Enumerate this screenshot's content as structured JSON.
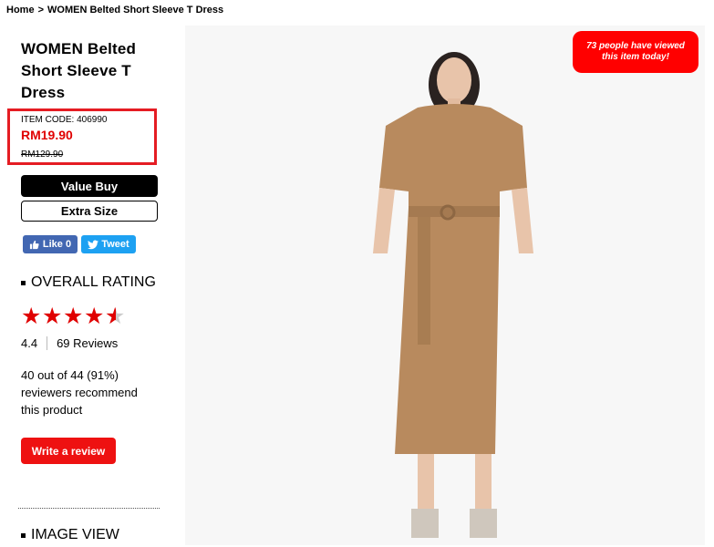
{
  "breadcrumb": {
    "home": "Home",
    "separator": ">",
    "current": "WOMEN Belted Short Sleeve T Dress"
  },
  "product": {
    "title": "WOMEN Belted Short Sleeve T Dress",
    "item_code": "ITEM CODE: 406990",
    "price": "RM19.90",
    "original_price": "RM129.90"
  },
  "buttons": {
    "value_buy": "Value Buy",
    "extra_size": "Extra Size",
    "write_review": "Write a review"
  },
  "social": {
    "like_label": "Like 0",
    "tweet_label": "Tweet",
    "like_icon": "thumbs-up-icon",
    "tweet_icon": "twitter-bird-icon"
  },
  "rating": {
    "heading": "OVERALL RATING",
    "stars": 4.4,
    "max_stars": 5,
    "score": "4.4",
    "reviews": "69 Reviews",
    "recommend": "40 out of 44 (91%) reviewers recommend this product"
  },
  "image_view": {
    "heading": "IMAGE VIEW"
  },
  "badge": {
    "viewed": "73 people have viewed this item today!"
  },
  "colors": {
    "accent_red": "#e00000",
    "facebook": "#4267b2",
    "twitter": "#1da1f2",
    "dress": "#b88a5e"
  }
}
